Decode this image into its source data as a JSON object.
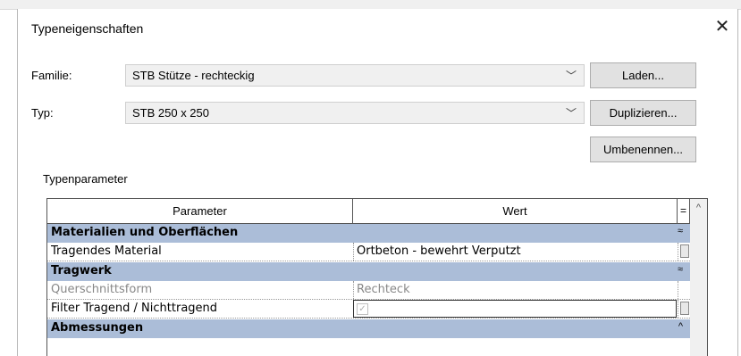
{
  "dialog": {
    "title": "Typeneigenschaften",
    "close_glyph": "✕"
  },
  "family": {
    "label": "Familie:",
    "value": "STB Stütze - rechteckig",
    "arrow": "﹀"
  },
  "type": {
    "label": "Typ:",
    "value": "STB 250 x 250",
    "arrow": "﹀"
  },
  "buttons": {
    "load": "Laden...",
    "duplicate": "Duplizieren...",
    "rename": "Umbenennen..."
  },
  "type_params_label": "Typenparameter",
  "grid": {
    "col_parameter": "Parameter",
    "col_value": "Wert",
    "col_eq": "=",
    "scroll_up": "^",
    "sections": [
      {
        "title": "Materialien und Oberflächen",
        "chevron": "≈"
      },
      {
        "title": "Tragwerk",
        "chevron": "≈"
      },
      {
        "title": "Abmessungen",
        "chevron": "^"
      }
    ],
    "rows": [
      {
        "param": "Tragendes Material",
        "value": "Ortbeton - bewehrt Verputzt"
      },
      {
        "param": "Querschnittsform",
        "value": "Rechteck"
      },
      {
        "param": "Filter Tragend / Nichttragend",
        "value": "✓"
      }
    ]
  },
  "colors": {
    "section_bg": "#abbdd8",
    "button_bg": "#e1e1e1",
    "combo_bg": "#f0f0f0"
  }
}
